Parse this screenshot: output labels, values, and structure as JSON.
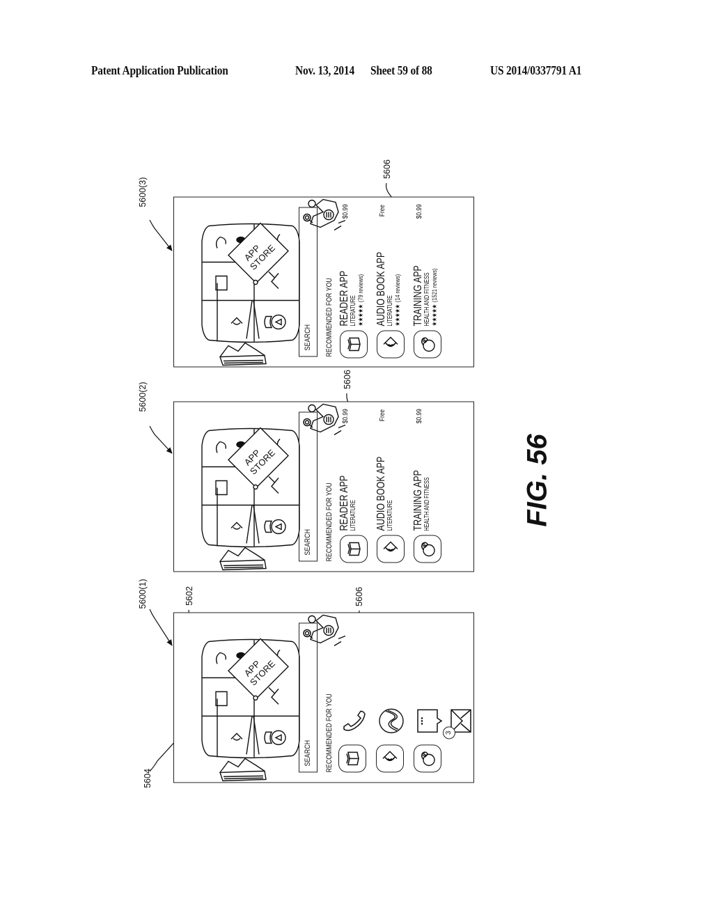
{
  "header": {
    "publication_type": "Patent Application Publication",
    "date": "Nov. 13, 2014",
    "sheet": "Sheet 59 of 88",
    "publication_number": "US 2014/0337791 A1"
  },
  "figure": {
    "label": "FIG. 56"
  },
  "reference_numerals": {
    "panel_1": "5600(1)",
    "panel_2": "5600(2)",
    "panel_3": "5600(3)",
    "carousel": "5602",
    "menu": "5604",
    "recommendations_1": "5606",
    "recommendations_2": "5606",
    "recommendations_3": "5606"
  },
  "panels": [
    {
      "id": "5600(1)",
      "scene": {
        "tag_line_1": "APP",
        "tag_line_2": "STORE"
      },
      "search": {
        "placeholder": "SEARCH"
      },
      "recommended_title": "RECOMMENDED FOR YOU",
      "mode": "icons",
      "recommended_icons": [
        "book-icon",
        "audio-book-icon",
        "training-icon"
      ],
      "dock": [
        {
          "icon": "phone-icon"
        },
        {
          "icon": "browser-globe-icon"
        },
        {
          "icon": "chat-bubble-icon"
        },
        {
          "icon": "mail-icon",
          "badge": "3"
        }
      ]
    },
    {
      "id": "5600(2)",
      "scene": {
        "tag_line_1": "APP",
        "tag_line_2": "STORE"
      },
      "search": {
        "placeholder": "SEARCH"
      },
      "recommended_title": "RECOMMENDED FOR YOU",
      "mode": "list",
      "apps": [
        {
          "name": "READER APP",
          "category": "LITERATURE",
          "price": "$0.99",
          "icon": "book-icon"
        },
        {
          "name": "AUDIO BOOK APP",
          "category": "LITERATURE",
          "price": "Free",
          "icon": "audio-book-icon"
        },
        {
          "name": "TRAINING APP",
          "category": "HEALTH AND FITNESS",
          "price": "$0.99",
          "icon": "training-icon"
        }
      ]
    },
    {
      "id": "5600(3)",
      "scene": {
        "tag_line_1": "APP",
        "tag_line_2": "STORE"
      },
      "search": {
        "placeholder": "SEARCH"
      },
      "recommended_title": "RECOMMENDED FOR YOU",
      "mode": "list-detailed",
      "apps": [
        {
          "name": "READER APP",
          "category": "LITERATURE",
          "price": "$0.99",
          "icon": "book-icon",
          "stars": "★★★★★",
          "rating": 5,
          "reviews": "(79 reviews)"
        },
        {
          "name": "AUDIO BOOK APP",
          "category": "LITERATURE",
          "price": "Free",
          "icon": "audio-book-icon",
          "stars": "★★★★★",
          "rating": 5,
          "reviews": "(14 reviews)"
        },
        {
          "name": "TRAINING APP",
          "category": "HEALTH AND FITNESS",
          "price": "$0.99",
          "icon": "training-icon",
          "stars": "★★★★★",
          "rating": 5,
          "reviews": "(1521 reviews)"
        }
      ]
    }
  ]
}
